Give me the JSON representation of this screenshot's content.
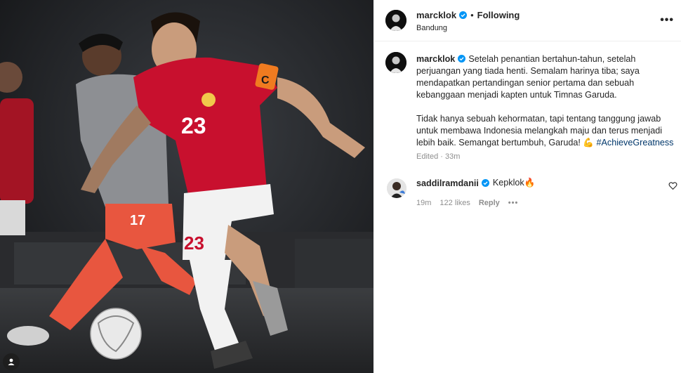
{
  "post": {
    "author": "marcklok",
    "follow_status": "Following",
    "separator": "•",
    "location": "Bandung",
    "more_label": "•••",
    "caption_p1": "Setelah penantian bertahun-tahun, setelah perjuangan yang tiada henti. Semalam harinya tiba; saya mendapatkan pertandingan senior pertama dan sebuah kebanggaan menjadi kapten untuk Timnas Garuda.",
    "caption_p2": "Tidak hanya sebuah kehormatan, tapi tentang tanggung jawab untuk membawa Indonesia melangkah maju dan terus menjadi lebih baik. Semangat bertumbuh, Garuda! 💪",
    "hashtag": "#AchieveGreatness",
    "edited_label": "Edited",
    "edited_time": "· 33m"
  },
  "photo": {
    "captain_number": "23",
    "captain_armband": "C",
    "opponent_number": "17"
  },
  "comment": {
    "author": "saddilramdanii",
    "text": "Kepklok🔥",
    "time": "19m",
    "likes": "122 likes",
    "reply_label": "Reply",
    "more_label": "•••"
  },
  "colors": {
    "accent_blue": "#0095f6",
    "hashtag": "#00376b",
    "jersey_red": "#c8102e",
    "jersey_orange": "#e8563f"
  }
}
